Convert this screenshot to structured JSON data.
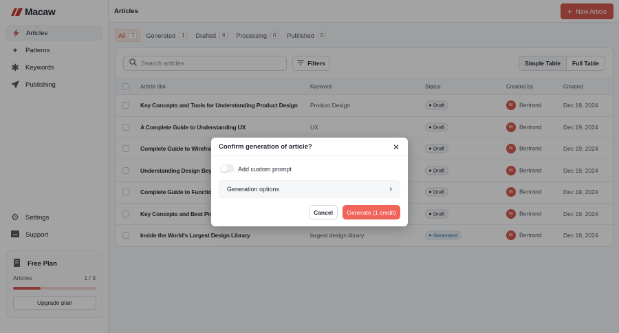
{
  "app": {
    "name": "Macaw"
  },
  "sidebar": {
    "items": [
      {
        "label": "Articles",
        "icon": "bolt-icon"
      },
      {
        "label": "Patterns",
        "icon": "sparkles-icon"
      },
      {
        "label": "Keywords",
        "icon": "asterisk-icon"
      },
      {
        "label": "Publishing",
        "icon": "send-icon"
      }
    ],
    "bottom": [
      {
        "label": "Settings",
        "icon": "gear-icon"
      },
      {
        "label": "Support",
        "icon": "support-icon"
      }
    ],
    "plan": {
      "name": "Free Plan",
      "metric": "Articles",
      "usage": "1 / 3",
      "progress": 0.33,
      "upgrade": "Upgrade plan"
    }
  },
  "header": {
    "title": "Articles",
    "new_button": "New Article"
  },
  "tabs": [
    {
      "label": "All",
      "count": "7"
    },
    {
      "label": "Generated",
      "count": "1"
    },
    {
      "label": "Drafted",
      "count": "6"
    },
    {
      "label": "Processing",
      "count": "0"
    },
    {
      "label": "Published",
      "count": "0"
    }
  ],
  "toolbar": {
    "search_placeholder": "Search articles",
    "filters": "Filters",
    "simple": "Simple Table",
    "full": "Full Table"
  },
  "table": {
    "columns": [
      "Article title",
      "Keyword",
      "Status",
      "Created by",
      "Created"
    ],
    "rows": [
      {
        "title": "Key Concepts and Tools for Understanding Product Design",
        "keyword": "Product Design",
        "status": "Draft",
        "by": "Bertrand",
        "initials": "BE",
        "date": "Dec 19, 2024"
      },
      {
        "title": "A Complete Guide to Understanding UX",
        "keyword": "UX",
        "status": "Draft",
        "by": "Bertrand",
        "initials": "BE",
        "date": "Dec 19, 2024"
      },
      {
        "title": "Complete Guide to Wirefram",
        "keyword": "",
        "status": "Draft",
        "by": "Bertrand",
        "initials": "BE",
        "date": "Dec 19, 2024"
      },
      {
        "title": "Understanding Design Beyo",
        "keyword": "",
        "status": "Draft",
        "by": "Bertrand",
        "initials": "BE",
        "date": "Dec 19, 2024"
      },
      {
        "title": "Complete Guide to Functiona",
        "keyword": "",
        "status": "Draft",
        "by": "Bertrand",
        "initials": "BE",
        "date": "Dec 19, 2024"
      },
      {
        "title": "Key Concepts and Best Prac",
        "keyword": "",
        "status": "Draft",
        "by": "Bertrand",
        "initials": "BE",
        "date": "Dec 19, 2024"
      },
      {
        "title": "Inside the World's Largest Design Library",
        "keyword": "largest design library",
        "status": "Generated",
        "by": "Bertrand",
        "initials": "BE",
        "date": "Dec 18, 2024"
      }
    ]
  },
  "modal": {
    "title": "Confirm generation of article?",
    "toggle_label": "Add custom prompt",
    "toggle_on": false,
    "options": "Generation options",
    "cancel": "Cancel",
    "confirm": "Generate (1 credit)"
  },
  "colors": {
    "accent": "#e8564a"
  }
}
